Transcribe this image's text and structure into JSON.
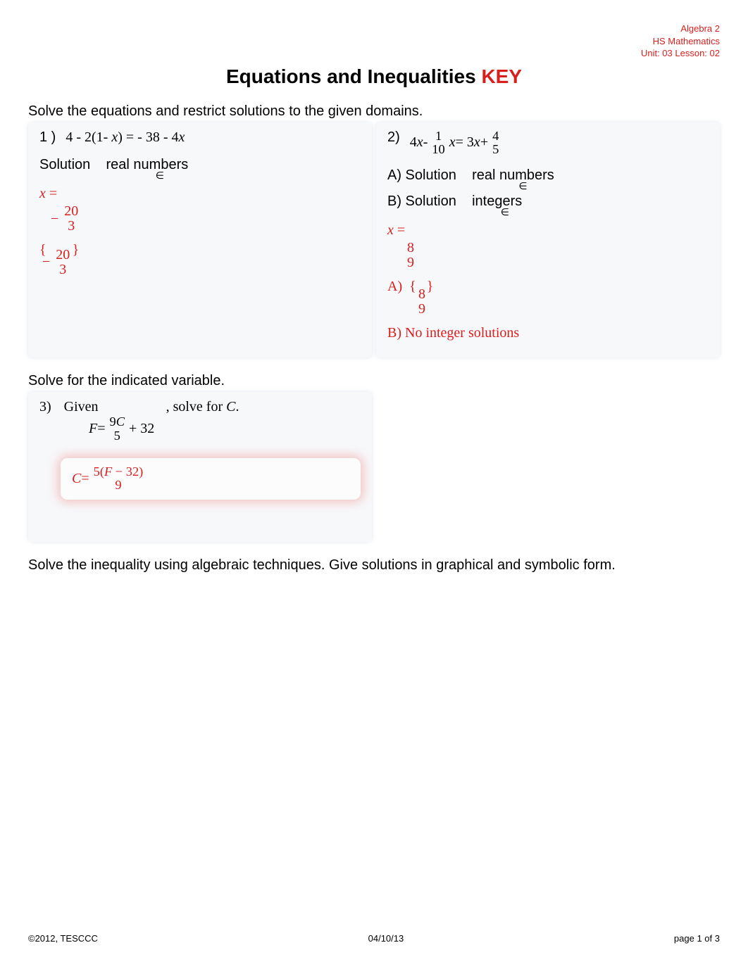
{
  "meta": {
    "course": "Algebra 2",
    "subject": "HS Mathematics",
    "unit": "Unit: 03 Lesson: 02"
  },
  "title": {
    "main": "Equations and Inequalities",
    "key": "KEY"
  },
  "section1": {
    "instruction": "Solve the equations and restrict solutions to the given domains."
  },
  "q1": {
    "num": "1 )",
    "eq_lhs_a": "4 -  2(1-  ",
    "eq_var": "x",
    "eq_lhs_b": ") = - 38 -  4",
    "domain_sol": "Solution",
    "domain_set": "real numbers",
    "elof": "∈",
    "ans_x": "x",
    "ans_eq": " =",
    "ans_neg": "−",
    "ans_num": "20",
    "ans_den": "3",
    "set_open": "{",
    "set_close": "}"
  },
  "q2": {
    "num": "2)",
    "eq_4x": "4",
    "eq_x": "x",
    "eq_minus": " - ",
    "frac1_num": "1",
    "frac1_den": "10",
    "eq_mid": " = 3",
    "eq_plus": " + ",
    "frac2_num": "4",
    "frac2_den": "5",
    "dA": "A)  Solution",
    "dA_set": "real numbers",
    "dB": "B)  Solution",
    "dB_set": "integers",
    "elof": "∈",
    "ans_x": "x",
    "ans_eq": " =",
    "ans_num": "8",
    "ans_den": "9",
    "aA": "A)",
    "set_open": "{",
    "set_close": "}",
    "aB": "B)  No integer solutions"
  },
  "section2": {
    "instruction": "Solve for the indicated variable."
  },
  "q3": {
    "num": "3)",
    "given": "Given",
    "solvefor": ", solve for ",
    "C": "C",
    "period": ".",
    "F": "F",
    "eq": " = ",
    "nine": "9",
    "five": "5",
    "plus32": " + 32",
    "ans_C": "C",
    "ans_eq": " = ",
    "ans_5": "5(",
    "ans_Fminus": " − 32)",
    "ans_9": "9"
  },
  "section3": {
    "instruction": "Solve the inequality using algebraic techniques. Give solutions in graphical and symbolic form."
  },
  "footer": {
    "left": "©2012, TESCCC",
    "center": "04/10/13",
    "right": "page 1 of 3"
  }
}
